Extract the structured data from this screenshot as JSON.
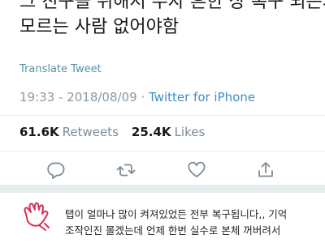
{
  "tweet": {
    "text_lines": [
      "그 친구들 위해서 주자 흔한 상 복구 되는지",
      "모르는 사람 없어야함"
    ],
    "translate_label": "Translate Tweet",
    "time": "19:33",
    "date": "2018/08/09",
    "via": "Twitter for iPhone",
    "retweets": "61.6K",
    "retweets_label": "Retweets",
    "likes": "25.4K",
    "likes_label": "Likes"
  },
  "actions": {
    "icons": [
      "reply-icon",
      "retweet-icon",
      "like-icon",
      "share-icon"
    ]
  },
  "comment": {
    "avatar_icon": "hand-outline-icon",
    "lines": [
      "탭이 얼마나 많이 켜져있었든 전부 복구됩니다,, 기억",
      "조작인진 몰겠는데 언제 한번 실수로 본체 꺼버려서"
    ]
  },
  "colors": {
    "link": "#3d8fc6",
    "muted": "#8a99a6",
    "icon": "#7f8c97",
    "separator_band": "#e7ecef",
    "hand_stroke": "#d2325a"
  }
}
